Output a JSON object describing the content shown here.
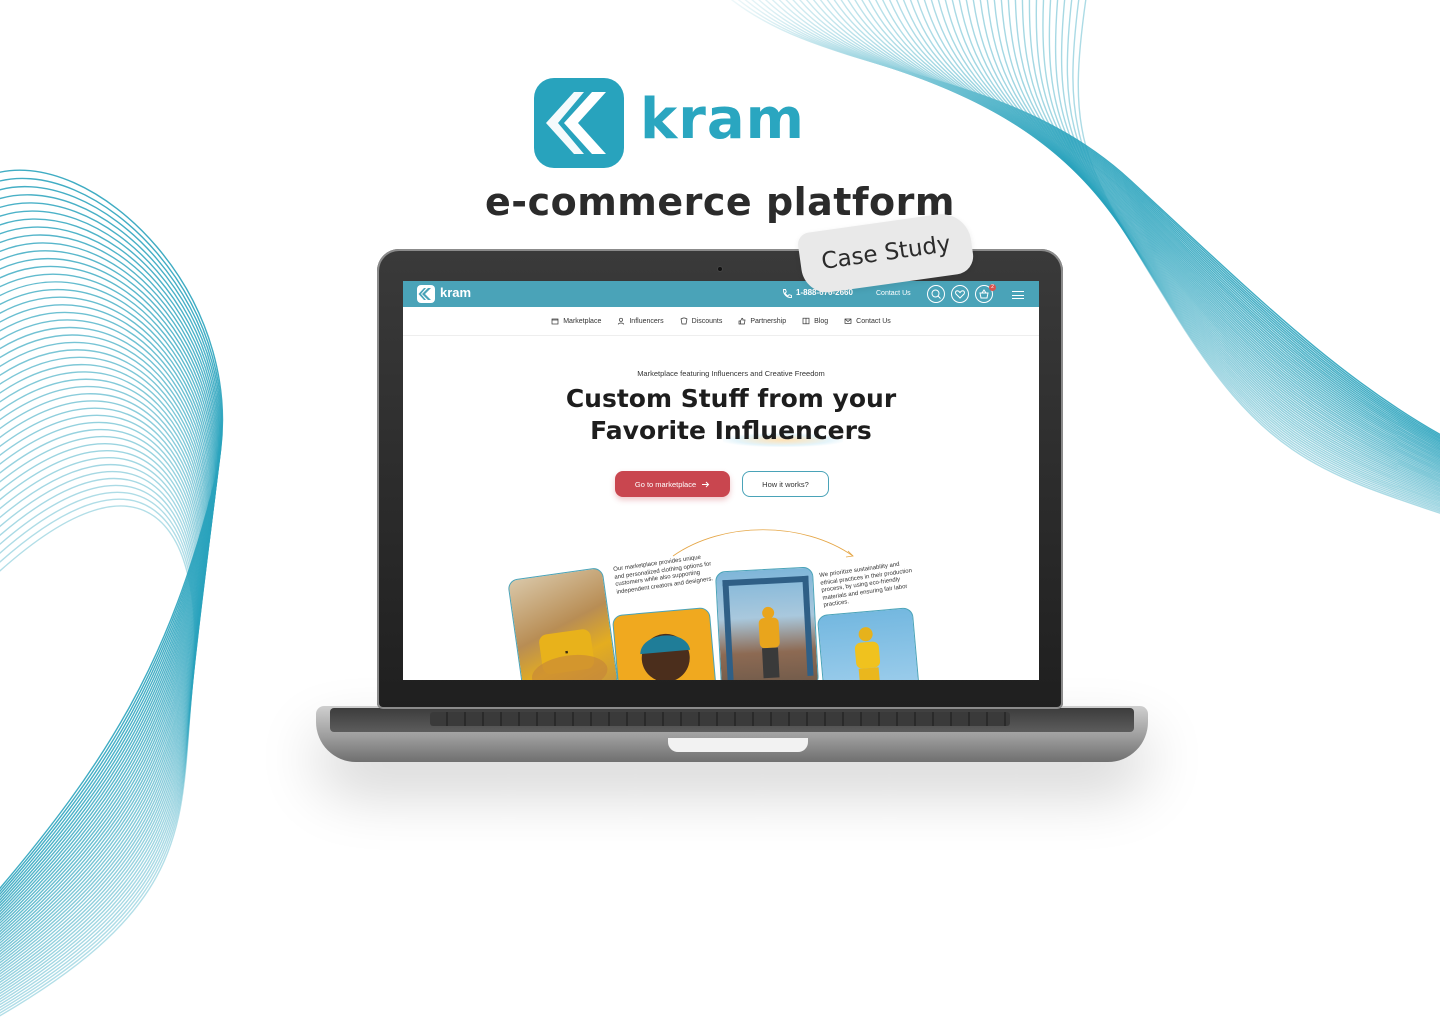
{
  "brand": {
    "name": "kram",
    "tagline": "e-commerce platform",
    "badge": "Case Study",
    "colors": {
      "accent": "#28a3bd",
      "topbar": "#4aa3b8",
      "primary_button": "#c9464f"
    }
  },
  "site": {
    "topbar": {
      "logo": "kram",
      "phone": "1-888-676-2660",
      "contact": "Contact Us",
      "cart_count": "2",
      "icons": [
        "phone-icon",
        "search-icon",
        "heart-icon",
        "basket-icon",
        "menu-icon"
      ]
    },
    "nav": [
      {
        "label": "Marketplace",
        "icon": "store-icon"
      },
      {
        "label": "Influencers",
        "icon": "user-icon"
      },
      {
        "label": "Discounts",
        "icon": "tag-icon"
      },
      {
        "label": "Partnership",
        "icon": "thumbs-up-icon"
      },
      {
        "label": "Blog",
        "icon": "book-icon"
      },
      {
        "label": "Contact Us",
        "icon": "mail-icon"
      }
    ],
    "hero": {
      "eyebrow": "Marketplace featuring Influencers and Creative Freedom",
      "headline_line1": "Custom Stuff from your",
      "headline_line2": "Favorite Influencers",
      "primary_button": "Go to marketplace",
      "secondary_button": "How it works?"
    },
    "blurbs": {
      "left": "Our marketplace provides unique and personalized clothing options for customers while also supporting independent creators and designers.",
      "right": "We prioritize sustainability and ethical practices in their production process, by using eco-friendly materials and ensuring fair labor practices."
    }
  }
}
